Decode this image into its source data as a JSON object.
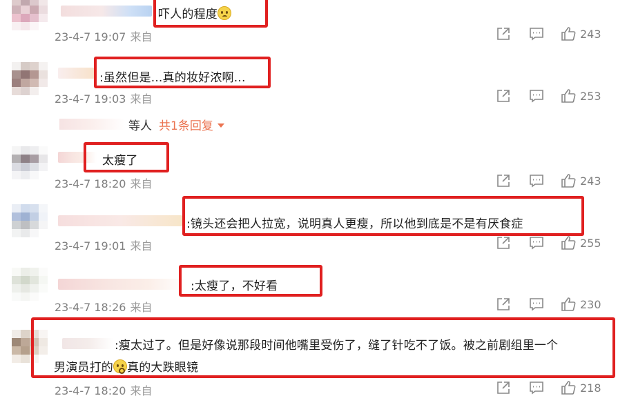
{
  "comments": [
    {
      "text": "吓人的程度",
      "emoji": "pleading-face-emoji",
      "date": "23-4-7 19:07",
      "source": "来自",
      "likes": "243"
    },
    {
      "text": ":虽然但是...真的妆好浓啊...",
      "date": "23-4-7 19:03",
      "source": "来自",
      "likes": "253"
    },
    {
      "text": "太瘦了",
      "date": "23-4-7 18:20",
      "source": "来自",
      "likes": "243"
    },
    {
      "text": ":镜头还会把人拉宽，说明真人更瘦，所以他到底是不是有厌食症",
      "date": "23-4-7 19:01",
      "source": "来自",
      "likes": "255"
    },
    {
      "text": ":太瘦了，不好看",
      "date": "23-4-7 18:26",
      "source": "来自",
      "likes": "230"
    },
    {
      "text_line1": ":瘦太过了。但是好像说那段时间他嘴里受伤了，缝了针吃不了饭。被之前剧组里一个",
      "text_line2_a": "男演员打的",
      "emoji": "flushed-face-emoji",
      "text_line2_b": "真的大跌眼镜",
      "date": "23-4-7 18:20",
      "source": "来自",
      "likes": "218"
    }
  ],
  "reply_summary": {
    "suffix": "等人",
    "link": "共1条回复"
  },
  "colors": {
    "highlight": "#e02020",
    "link": "#eb7350",
    "meta": "#808080"
  },
  "icons": {
    "share": "share-icon",
    "comment": "comment-icon",
    "like": "like-icon"
  }
}
